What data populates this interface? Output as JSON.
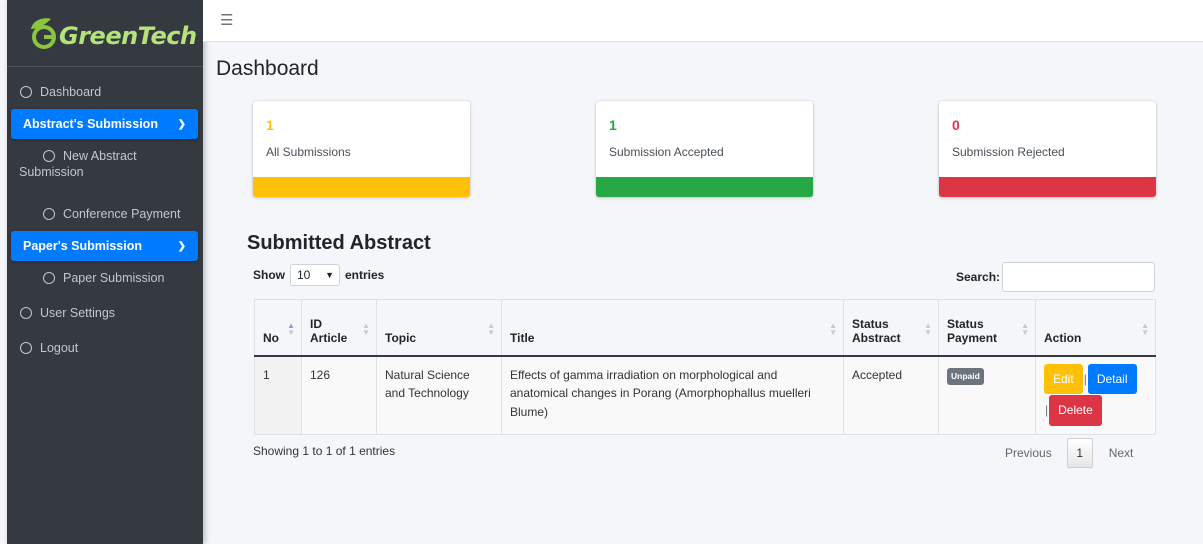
{
  "brand": {
    "name": "GreenTech"
  },
  "sidebar": {
    "dashboard": "Dashboard",
    "abstract_group": "Abstract's Submission",
    "new_abstract_line1": "New Abstract",
    "new_abstract_line2": "Submission",
    "conference_payment": "Conference Payment",
    "paper_group": "Paper's Submission",
    "paper_submission": "Paper Submission",
    "user_settings": "User Settings",
    "logout": "Logout"
  },
  "page": {
    "title": "Dashboard"
  },
  "stats": [
    {
      "value": "1",
      "label": "All Submissions",
      "color": "#ffc107"
    },
    {
      "value": "1",
      "label": "Submission Accepted",
      "color": "#28a745"
    },
    {
      "value": "0",
      "label": "Submission Rejected",
      "color": "#dc3545"
    }
  ],
  "section": {
    "title": "Submitted Abstract"
  },
  "length_menu": {
    "show": "Show",
    "value": "10",
    "entries": "entries"
  },
  "search": {
    "label": "Search:"
  },
  "table": {
    "headers": {
      "no": "No",
      "id_line1": "ID",
      "id_line2": "Article",
      "topic": "Topic",
      "title": "Title",
      "status_abstract_line1": "Status",
      "status_abstract_line2": "Abstract",
      "status_payment_line1": "Status",
      "status_payment_line2": "Payment",
      "action": "Action"
    },
    "rows": [
      {
        "no": "1",
        "id": "126",
        "topic": "Natural Science and Technology",
        "title": "Effects of gamma irradiation on morphological and anatomical changes in Porang (Amorphophallus muelleri Blume)",
        "status_abstract": "Accepted",
        "status_payment": "Unpaid",
        "edit": "Edit",
        "detail": "Detail",
        "delete": "Delete"
      }
    ]
  },
  "footer": {
    "info": "Showing 1 to 1 of 1 entries",
    "previous": "Previous",
    "page": "1",
    "next": "Next"
  }
}
